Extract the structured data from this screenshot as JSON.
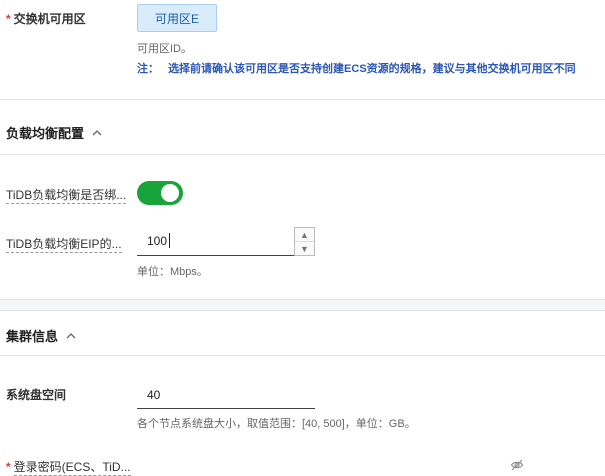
{
  "zone": {
    "label": "交换机可用区",
    "selected": "可用区E",
    "hint": "可用区ID。",
    "note_prefix": "注：",
    "note_text": "选择前请确认该可用区是否支持创建ECS资源的规格，建议与其他交换机可用区不同"
  },
  "lb_section": {
    "title": "负载均衡配置",
    "eip_toggle_label": "TiDB负载均衡是否绑...",
    "eip_toggle_on": true,
    "bandwidth_label": "TiDB负载均衡EIP的...",
    "bandwidth_value": "100",
    "bandwidth_hint": "单位：Mbps。"
  },
  "cluster_section": {
    "title": "集群信息",
    "disk_label": "系统盘空间",
    "disk_value": "40",
    "disk_hint": "各个节点系统盘大小，取值范围：[40, 500]，单位：GB。",
    "password_label": "登录密码(ECS、TiD..."
  },
  "colors": {
    "accent_green": "#19a33b",
    "required_red": "#e5383b",
    "note_blue": "#2a57b8",
    "chip_bg": "#d9ecfb"
  },
  "icons": {
    "collapse": "chevron-up-icon",
    "stepper_up": "caret-up-icon",
    "stepper_down": "caret-down-icon",
    "password_visibility": "eye-off-icon"
  }
}
